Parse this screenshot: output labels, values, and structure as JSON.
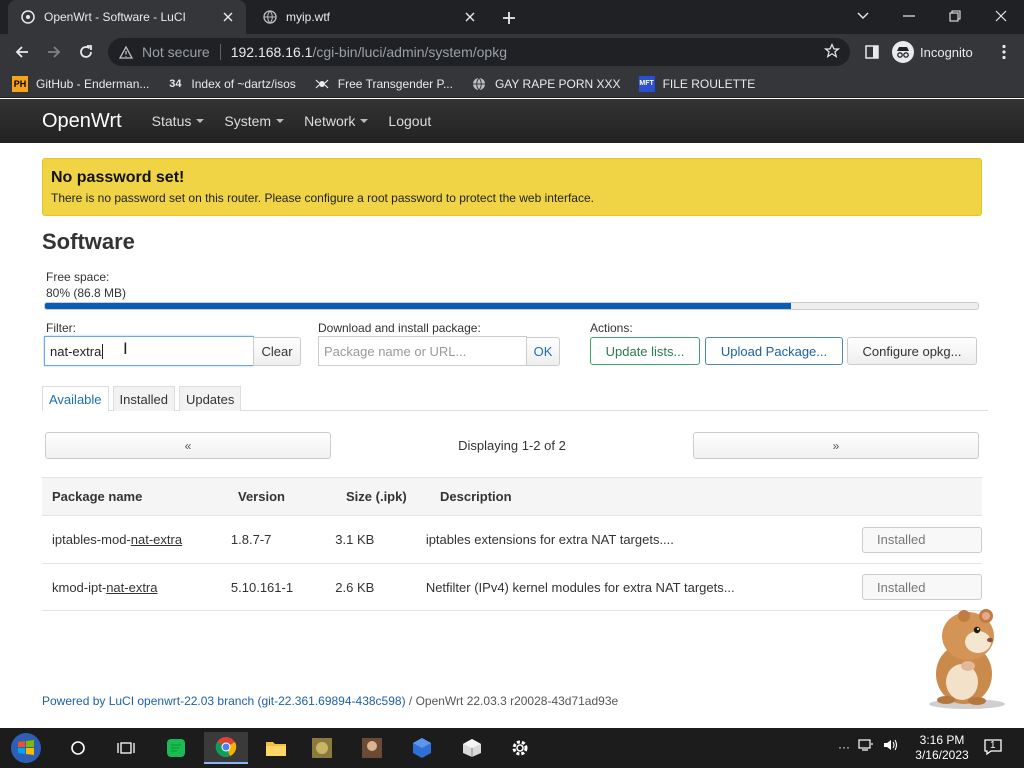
{
  "browser": {
    "tabs": [
      {
        "title": "OpenWrt - Software - LuCI",
        "active": true
      },
      {
        "title": "myip.wtf",
        "active": false
      }
    ],
    "url_security": "Not secure",
    "url_host": "192.168.16.1",
    "url_path": "/cgi-bin/luci/admin/system/opkg",
    "profile": "Incognito",
    "bookmarks": [
      {
        "label": "GitHub - Enderman...",
        "icon": "ph-icon"
      },
      {
        "label": "Index of ~dartz/isos",
        "icon": "34-icon"
      },
      {
        "label": "Free Transgender P...",
        "icon": "spider-icon"
      },
      {
        "label": "GAY RAPE PORN XXX",
        "icon": "globe-icon"
      },
      {
        "label": "FILE ROULETTE",
        "icon": "mft-icon"
      }
    ]
  },
  "luci": {
    "brand": "OpenWrt",
    "nav": [
      {
        "label": "Status",
        "dropdown": true
      },
      {
        "label": "System",
        "dropdown": true
      },
      {
        "label": "Network",
        "dropdown": true
      },
      {
        "label": "Logout",
        "dropdown": false
      }
    ],
    "alert": {
      "title": "No password set!",
      "text": "There is no password set on this router. Please configure a root password to protect the web interface.",
      "color": "#f0d445"
    },
    "page_title": "Software",
    "free_space_label": "Free space:",
    "free_space_value": "80% (86.8 MB)",
    "free_space_fraction": 0.8,
    "filter_label": "Filter:",
    "filter_value": "nat-extra",
    "clear_label": "Clear",
    "download_label": "Download and install package:",
    "download_placeholder": "Package name or URL...",
    "ok_label": "OK",
    "actions_label": "Actions:",
    "update_lists": "Update lists...",
    "upload_package": "Upload Package...",
    "configure_opkg": "Configure opkg...",
    "tabs": [
      "Available",
      "Installed",
      "Updates"
    ],
    "active_tab": "Available",
    "pager_prev": "«",
    "pager_next": "»",
    "displaying": "Displaying 1-2 of 2",
    "table": {
      "headers": [
        "Package name",
        "Version",
        "Size (.ipk)",
        "Description"
      ],
      "rows": [
        {
          "name_prefix": "iptables-mod-",
          "name_match": "nat-extra",
          "version": "1.8.7-7",
          "size": "3.1 KB",
          "description": "iptables extensions for extra NAT targets....",
          "status": "Installed"
        },
        {
          "name_prefix": "kmod-ipt-",
          "name_match": "nat-extra",
          "version": "5.10.161-1",
          "size": "2.6 KB",
          "description": "Netfilter (IPv4) kernel modules for extra NAT targets...",
          "status": "Installed"
        }
      ]
    },
    "footer_link": "Powered by LuCI openwrt-22.03 branch (git-22.361.69894-438c598)",
    "footer_text": " / OpenWrt 22.03.3 r20028-43d71ad93e"
  },
  "taskbar": {
    "time": "3:16 PM",
    "date": "3/16/2023",
    "notifications": "1"
  }
}
